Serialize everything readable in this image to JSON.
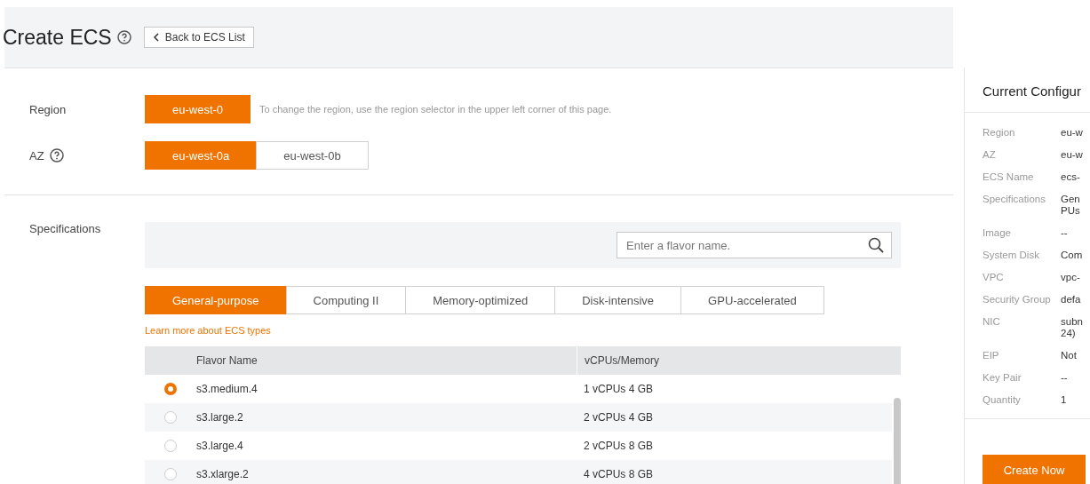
{
  "header": {
    "title": "Create ECS",
    "back_button": "Back to ECS List"
  },
  "region": {
    "label": "Region",
    "options": [
      {
        "label": "eu-west-0",
        "selected": true
      }
    ],
    "hint": "To change the region, use the region selector in the upper left corner of this page."
  },
  "az": {
    "label": "AZ",
    "options": [
      {
        "label": "eu-west-0a",
        "selected": true
      },
      {
        "label": "eu-west-0b",
        "selected": false
      }
    ]
  },
  "specifications": {
    "label": "Specifications",
    "search": {
      "placeholder": "Enter a flavor name."
    },
    "tabs": [
      {
        "label": "General-purpose",
        "selected": true
      },
      {
        "label": "Computing II",
        "selected": false
      },
      {
        "label": "Memory-optimized",
        "selected": false
      },
      {
        "label": "Disk-intensive",
        "selected": false
      },
      {
        "label": "GPU-accelerated",
        "selected": false
      }
    ],
    "learn_more_link": "Learn more about ECS types",
    "table": {
      "columns": [
        "Flavor Name",
        "vCPUs/Memory"
      ],
      "rows": [
        {
          "selected": true,
          "cells": [
            "s3.medium.4",
            "1 vCPUs 4 GB"
          ]
        },
        {
          "selected": false,
          "cells": [
            "s3.large.2",
            "2 vCPUs 4 GB"
          ]
        },
        {
          "selected": false,
          "cells": [
            "s3.large.4",
            "2 vCPUs 8 GB"
          ]
        },
        {
          "selected": false,
          "cells": [
            "s3.xlarge.2",
            "4 vCPUs 8 GB"
          ]
        }
      ]
    }
  },
  "current_configuration": {
    "title": "Current Configur",
    "items": [
      {
        "label": "Region",
        "value": [
          "eu-w"
        ]
      },
      {
        "label": "AZ",
        "value": [
          "eu-w"
        ]
      },
      {
        "label": "ECS Name",
        "value": [
          "ecs-"
        ]
      },
      {
        "label": "Specifications",
        "value": [
          "Gen",
          "PUs"
        ]
      },
      {
        "label": "Image",
        "value": [
          "--"
        ]
      },
      {
        "label": "System Disk",
        "value": [
          "Com"
        ]
      },
      {
        "label": "VPC",
        "value": [
          "vpc-"
        ]
      },
      {
        "label": "Security Group",
        "value": [
          "defa"
        ]
      },
      {
        "label": "NIC",
        "value": [
          "subn",
          "24)"
        ]
      },
      {
        "label": "EIP",
        "value": [
          "Not"
        ]
      },
      {
        "label": "Key Pair",
        "value": [
          "--"
        ]
      },
      {
        "label": "Quantity",
        "value": [
          "1"
        ]
      }
    ],
    "create_button": "Create Now"
  }
}
